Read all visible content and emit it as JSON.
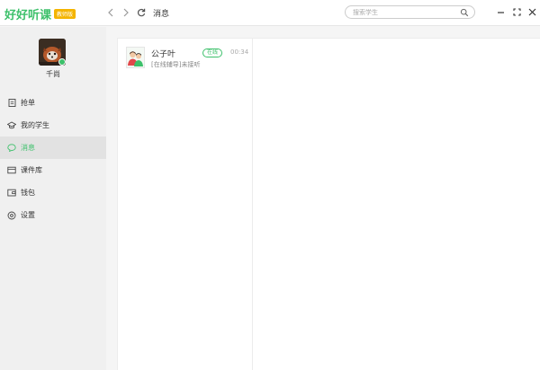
{
  "app": {
    "logo_text": "好好听课",
    "logo_badge": "教师版"
  },
  "header": {
    "title": "消息",
    "search_placeholder": "搜索学生"
  },
  "user": {
    "name": "千尚"
  },
  "sidebar": {
    "items": [
      {
        "label": "抢单",
        "icon": "clipboard-icon"
      },
      {
        "label": "我的学生",
        "icon": "graduation-cap-icon"
      },
      {
        "label": "消息",
        "icon": "chat-bubble-icon",
        "active": true
      },
      {
        "label": "课件库",
        "icon": "courseware-icon"
      },
      {
        "label": "钱包",
        "icon": "wallet-icon"
      },
      {
        "label": "设置",
        "icon": "settings-icon"
      }
    ]
  },
  "conversations": [
    {
      "name": "公子叶",
      "status": "在线",
      "time": "00:34",
      "preview": "[在线辅导]未接听"
    }
  ],
  "colors": {
    "accent": "#3cc06a",
    "badge": "#f4b400"
  }
}
